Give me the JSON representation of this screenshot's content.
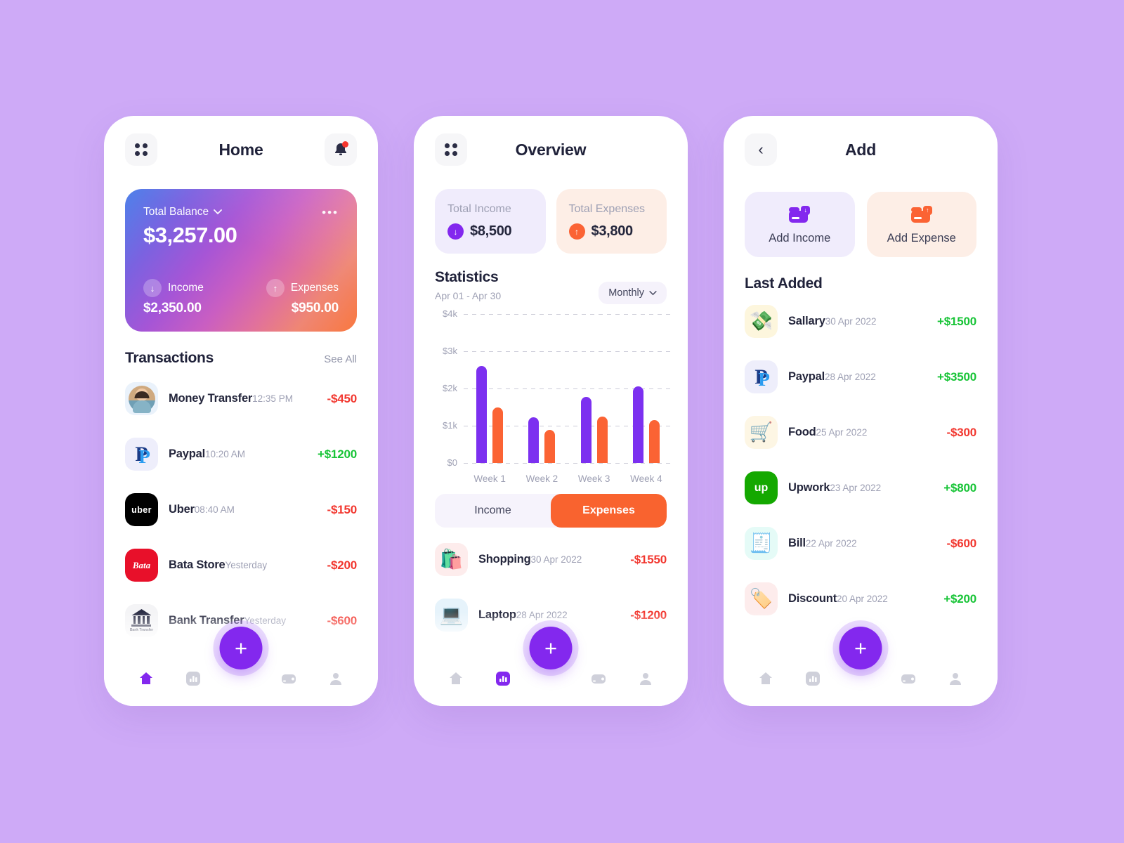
{
  "theme": {
    "background": "#ceaaf7",
    "purple": "#7c30f0",
    "orange": "#fb6334",
    "green": "#18c437",
    "red": "#f2372f",
    "fab": "#8328ee"
  },
  "home": {
    "title": "Home",
    "menu_icon": "grid-icon",
    "bell_icon": "bell-icon",
    "balance": {
      "label": "Total Balance",
      "amount": "$3,257.00",
      "more_icon": "more-dots-icon",
      "income_label": "Income",
      "income_value": "$2,350.00",
      "income_icon": "arrow-down-icon",
      "expenses_label": "Expenses",
      "expenses_value": "$950.00",
      "expenses_icon": "arrow-up-icon"
    },
    "transactions_title": "Transactions",
    "see_all": "See All",
    "transactions": [
      {
        "name": "Money Transfer",
        "time": "12:35 PM",
        "amount": "-$450",
        "sign": "neg",
        "icon": "avatar-photo",
        "bg": "#eaf2fb"
      },
      {
        "name": "Paypal",
        "time": "10:20 AM",
        "amount": "+$1200",
        "sign": "pos",
        "icon": "paypal-logo",
        "bg": "#eeeefb"
      },
      {
        "name": "Uber",
        "time": "08:40 AM",
        "amount": "-$150",
        "sign": "neg",
        "icon": "uber-logo",
        "bg": "#f3f3f3"
      },
      {
        "name": "Bata Store",
        "time": "Yesterday",
        "amount": "-$200",
        "sign": "neg",
        "icon": "bata-logo",
        "bg": "#fdeeef"
      },
      {
        "name": "Bank Transfer",
        "time": "Yesterday",
        "amount": "-$600",
        "sign": "neg",
        "icon": "bank-icon",
        "bg": "#f4f4f6"
      }
    ]
  },
  "overview": {
    "title": "Overview",
    "menu_icon": "grid-icon",
    "total_income_label": "Total Income",
    "total_income_value": "$8,500",
    "total_income_icon": "arrow-down-icon",
    "total_expenses_label": "Total Expenses",
    "total_expenses_value": "$3,800",
    "total_expenses_icon": "arrow-up-icon",
    "statistics_title": "Statistics",
    "date_range": "Apr 01 - Apr 30",
    "period": "Monthly",
    "period_icon": "chevron-down-icon",
    "tab_income": "Income",
    "tab_expenses": "Expenses",
    "active_tab": "Expenses",
    "expense_items": [
      {
        "name": "Shopping",
        "date": "30 Apr 2022",
        "amount": "-$1550",
        "sign": "neg",
        "icon": "shopping-bag-emoji",
        "bg": "#fdecec"
      },
      {
        "name": "Laptop",
        "date": "28 Apr 2022",
        "amount": "-$1200",
        "sign": "neg",
        "icon": "laptop-emoji",
        "bg": "#e6f3fb"
      }
    ]
  },
  "add": {
    "title": "Add",
    "back_icon": "chevron-left-icon",
    "add_income_label": "Add Income",
    "add_income_icon": "card-download-icon",
    "add_expense_label": "Add Expense",
    "add_expense_icon": "card-upload-icon",
    "last_added_title": "Last Added",
    "items": [
      {
        "name": "Sallary",
        "date": "30 Apr 2022",
        "amount": "+$1500",
        "sign": "pos",
        "icon": "money-envelope-emoji",
        "bg": "#fdf6dd"
      },
      {
        "name": "Paypal",
        "date": "28 Apr 2022",
        "amount": "+$3500",
        "sign": "pos",
        "icon": "paypal-logo",
        "bg": "#eeeefb"
      },
      {
        "name": "Food",
        "date": "25 Apr 2022",
        "amount": "-$300",
        "sign": "neg",
        "icon": "grocery-bag-emoji",
        "bg": "#fdf6e4"
      },
      {
        "name": "Upwork",
        "date": "23 Apr 2022",
        "amount": "+$800",
        "sign": "pos",
        "icon": "upwork-logo",
        "bg": "#eafbee"
      },
      {
        "name": "Bill",
        "date": "22 Apr 2022",
        "amount": "-$600",
        "sign": "neg",
        "icon": "bill-emoji",
        "bg": "#e5fbf7"
      },
      {
        "name": "Discount",
        "date": "20 Apr 2022",
        "amount": "+$200",
        "sign": "pos",
        "icon": "discount-tag-emoji",
        "bg": "#fdecec"
      }
    ]
  },
  "nav": {
    "items": [
      {
        "icon": "home-icon",
        "active_on": "home"
      },
      {
        "icon": "chart-icon",
        "active_on": "overview"
      },
      {
        "icon": "wallet-icon",
        "active_on": "none"
      },
      {
        "icon": "profile-icon",
        "active_on": "none"
      }
    ],
    "fab_label": "+",
    "fab_icon": "plus-icon"
  },
  "chart_data": {
    "type": "bar",
    "title": "Statistics",
    "subtitle": "Apr 01 - Apr 30",
    "categories": [
      "Week 1",
      "Week 2",
      "Week 3",
      "Week 4"
    ],
    "series": [
      {
        "name": "Income",
        "color": "#7c30f0",
        "values": [
          2600,
          1230,
          1780,
          2060
        ]
      },
      {
        "name": "Expenses",
        "color": "#fb6334",
        "values": [
          1500,
          880,
          1250,
          1150
        ]
      }
    ],
    "ylabel": "",
    "xlabel": "",
    "ylim": [
      0,
      4000
    ],
    "ytick_labels": [
      "$0",
      "$1k",
      "$2k",
      "$3k",
      "$4k"
    ],
    "ytick_values": [
      0,
      1000,
      2000,
      3000,
      4000
    ],
    "grid": true,
    "grid_style": "dashed-horizontal",
    "legend": "none"
  }
}
